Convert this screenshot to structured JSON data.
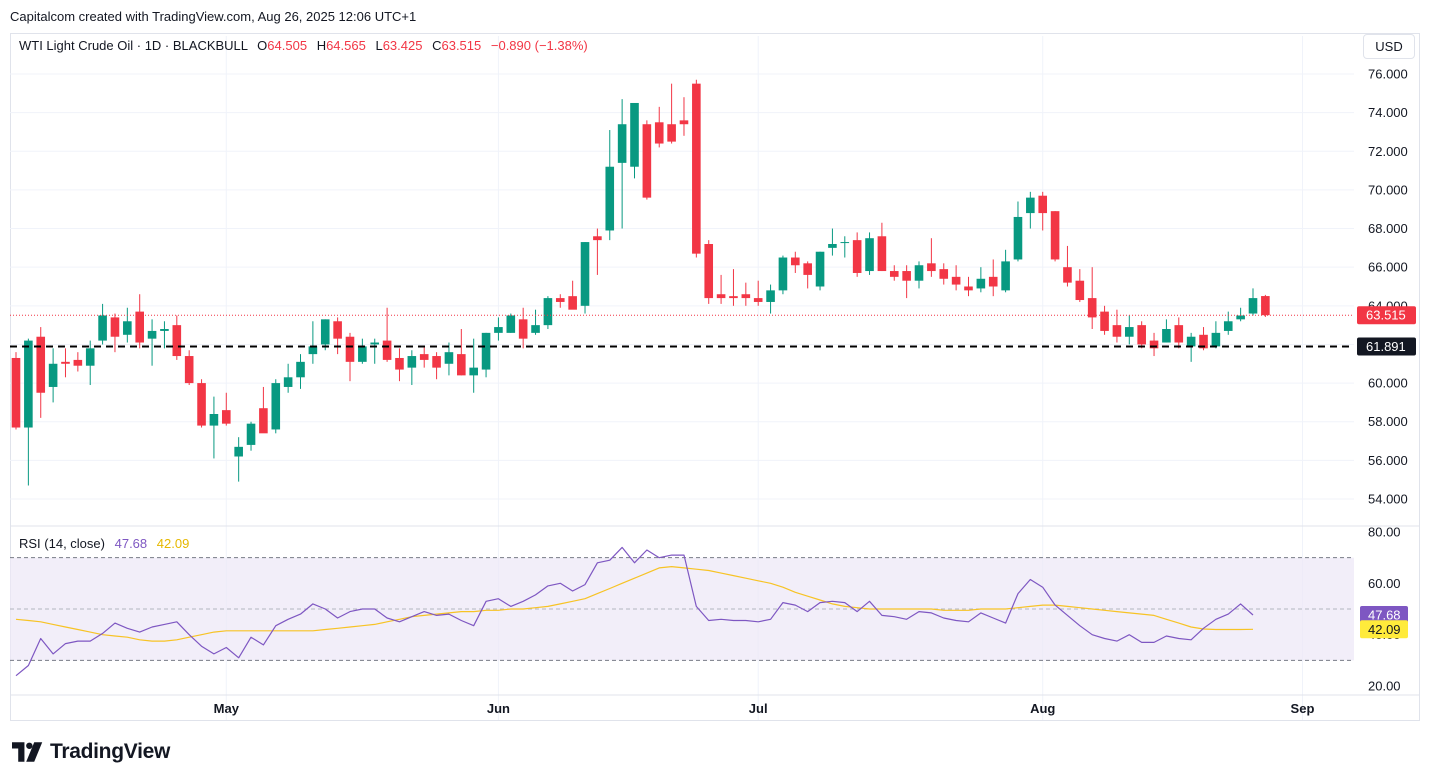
{
  "header": {
    "text": "Capitalcom created with TradingView.com, Aug 26, 2025 12:06 UTC+1"
  },
  "legend": {
    "symbol": "WTI Light Crude Oil · 1D · BLACKBULL",
    "o_label": "O",
    "o": "64.505",
    "h_label": "H",
    "h": "64.565",
    "l_label": "L",
    "l": "63.425",
    "c_label": "C",
    "c": "63.515",
    "change": "−0.890 (−1.38%)"
  },
  "currency": "USD",
  "rsi_legend": {
    "label": "RSI (14, close)",
    "rsi": "47.68",
    "ma": "42.09"
  },
  "brand": {
    "name": "TradingView",
    "icon": "tradingview-logo-icon"
  },
  "colors": {
    "up": "#089981",
    "down": "#f23645",
    "rsi": "#7e57c2",
    "rsi_ma": "#f7c325",
    "rsi_band": "#ede7f6"
  },
  "chart_data": [
    {
      "type": "candlestick",
      "price_ylim": [
        53,
        77
      ],
      "y_ticks": [
        "54.000",
        "56.000",
        "58.000",
        "60.000",
        "62.000",
        "64.000",
        "66.000",
        "68.000",
        "70.000",
        "72.000",
        "74.000",
        "76.000"
      ],
      "x_ticks": [
        {
          "label": "May",
          "date": "2025-05-01"
        },
        {
          "label": "Jun",
          "date": "2025-06-02"
        },
        {
          "label": "Jul",
          "date": "2025-07-01"
        },
        {
          "label": "Aug",
          "date": "2025-08-01"
        },
        {
          "label": "Sep",
          "date": "2025-09-01"
        }
      ],
      "candles": [
        {
          "date": "2025-04-07",
          "o": 61.3,
          "h": 61.6,
          "l": 57.6,
          "c": 57.7
        },
        {
          "date": "2025-04-08",
          "o": 57.7,
          "h": 62.3,
          "l": 54.7,
          "c": 62.2
        },
        {
          "date": "2025-04-09",
          "o": 62.4,
          "h": 62.9,
          "l": 58.2,
          "c": 59.5
        },
        {
          "date": "2025-04-10",
          "o": 59.8,
          "h": 61.8,
          "l": 59.0,
          "c": 61.0
        },
        {
          "date": "2025-04-11",
          "o": 61.1,
          "h": 61.8,
          "l": 60.3,
          "c": 61.0
        },
        {
          "date": "2025-04-14",
          "o": 61.2,
          "h": 61.6,
          "l": 60.6,
          "c": 60.9
        },
        {
          "date": "2025-04-15",
          "o": 60.9,
          "h": 62.2,
          "l": 59.9,
          "c": 61.8
        },
        {
          "date": "2025-04-16",
          "o": 62.2,
          "h": 64.1,
          "l": 62.0,
          "c": 63.5
        },
        {
          "date": "2025-04-17",
          "o": 63.4,
          "h": 63.6,
          "l": 61.6,
          "c": 62.4
        },
        {
          "date": "2025-04-21",
          "o": 62.5,
          "h": 63.9,
          "l": 62.1,
          "c": 63.2
        },
        {
          "date": "2025-04-22",
          "o": 63.7,
          "h": 64.6,
          "l": 61.8,
          "c": 62.1
        },
        {
          "date": "2025-04-23",
          "o": 62.3,
          "h": 63.3,
          "l": 60.9,
          "c": 62.7
        },
        {
          "date": "2025-04-24",
          "o": 62.7,
          "h": 63.2,
          "l": 61.8,
          "c": 62.8
        },
        {
          "date": "2025-04-25",
          "o": 63.0,
          "h": 63.5,
          "l": 61.2,
          "c": 61.4
        },
        {
          "date": "2025-04-28",
          "o": 61.4,
          "h": 61.7,
          "l": 59.9,
          "c": 60.0
        },
        {
          "date": "2025-04-29",
          "o": 60.0,
          "h": 60.2,
          "l": 57.7,
          "c": 57.8
        },
        {
          "date": "2025-04-30",
          "o": 57.8,
          "h": 59.3,
          "l": 56.1,
          "c": 58.4
        },
        {
          "date": "2025-05-01",
          "o": 58.6,
          "h": 59.5,
          "l": 57.8,
          "c": 57.9
        },
        {
          "date": "2025-05-02",
          "o": 56.2,
          "h": 57.2,
          "l": 54.9,
          "c": 56.7
        },
        {
          "date": "2025-05-05",
          "o": 56.8,
          "h": 58.0,
          "l": 56.5,
          "c": 57.9
        },
        {
          "date": "2025-05-06",
          "o": 58.7,
          "h": 59.8,
          "l": 57.6,
          "c": 57.4
        },
        {
          "date": "2025-05-07",
          "o": 57.6,
          "h": 60.2,
          "l": 57.4,
          "c": 60.0
        },
        {
          "date": "2025-05-08",
          "o": 59.8,
          "h": 61.0,
          "l": 59.5,
          "c": 60.3
        },
        {
          "date": "2025-05-09",
          "o": 60.3,
          "h": 61.5,
          "l": 59.7,
          "c": 61.1
        },
        {
          "date": "2025-05-12",
          "o": 61.5,
          "h": 63.2,
          "l": 61.0,
          "c": 61.9
        },
        {
          "date": "2025-05-13",
          "o": 62.0,
          "h": 63.3,
          "l": 61.7,
          "c": 63.3
        },
        {
          "date": "2025-05-14",
          "o": 63.2,
          "h": 63.4,
          "l": 61.5,
          "c": 62.3
        },
        {
          "date": "2025-05-15",
          "o": 62.4,
          "h": 62.6,
          "l": 60.1,
          "c": 61.1
        },
        {
          "date": "2025-05-16",
          "o": 61.1,
          "h": 62.3,
          "l": 61.0,
          "c": 61.9
        },
        {
          "date": "2025-05-19",
          "o": 62.0,
          "h": 62.3,
          "l": 61.0,
          "c": 62.1
        },
        {
          "date": "2025-05-20",
          "o": 62.2,
          "h": 63.9,
          "l": 61.1,
          "c": 61.2
        },
        {
          "date": "2025-05-21",
          "o": 61.3,
          "h": 61.8,
          "l": 60.1,
          "c": 60.7
        },
        {
          "date": "2025-05-22",
          "o": 60.8,
          "h": 61.7,
          "l": 59.9,
          "c": 61.4
        },
        {
          "date": "2025-05-23",
          "o": 61.5,
          "h": 61.9,
          "l": 60.8,
          "c": 61.2
        },
        {
          "date": "2025-05-26",
          "o": 61.4,
          "h": 61.6,
          "l": 60.2,
          "c": 60.8
        },
        {
          "date": "2025-05-27",
          "o": 61.0,
          "h": 62.1,
          "l": 60.4,
          "c": 61.6
        },
        {
          "date": "2025-05-28",
          "o": 61.5,
          "h": 62.8,
          "l": 60.4,
          "c": 60.4
        },
        {
          "date": "2025-05-29",
          "o": 60.4,
          "h": 62.3,
          "l": 59.5,
          "c": 60.8
        },
        {
          "date": "2025-05-30",
          "o": 60.7,
          "h": 62.6,
          "l": 60.3,
          "c": 62.6
        },
        {
          "date": "2025-06-02",
          "o": 62.6,
          "h": 63.4,
          "l": 62.2,
          "c": 62.9
        },
        {
          "date": "2025-06-03",
          "o": 62.6,
          "h": 63.6,
          "l": 62.6,
          "c": 63.5
        },
        {
          "date": "2025-06-04",
          "o": 63.3,
          "h": 63.9,
          "l": 61.8,
          "c": 62.3
        },
        {
          "date": "2025-06-05",
          "o": 62.6,
          "h": 63.8,
          "l": 62.5,
          "c": 63.0
        },
        {
          "date": "2025-06-06",
          "o": 63.0,
          "h": 64.5,
          "l": 62.8,
          "c": 64.4
        },
        {
          "date": "2025-06-09",
          "o": 64.4,
          "h": 64.6,
          "l": 63.9,
          "c": 64.2
        },
        {
          "date": "2025-06-10",
          "o": 64.5,
          "h": 65.3,
          "l": 63.9,
          "c": 63.8
        },
        {
          "date": "2025-06-11",
          "o": 64.0,
          "h": 67.3,
          "l": 63.6,
          "c": 67.3
        },
        {
          "date": "2025-06-12",
          "o": 67.6,
          "h": 68.0,
          "l": 65.6,
          "c": 67.4
        },
        {
          "date": "2025-06-13",
          "o": 67.9,
          "h": 73.1,
          "l": 67.4,
          "c": 71.2
        },
        {
          "date": "2025-06-16",
          "o": 71.4,
          "h": 74.7,
          "l": 68.0,
          "c": 73.4
        },
        {
          "date": "2025-06-17",
          "o": 71.2,
          "h": 74.5,
          "l": 70.6,
          "c": 74.5
        },
        {
          "date": "2025-06-18",
          "o": 73.4,
          "h": 73.6,
          "l": 69.5,
          "c": 69.6
        },
        {
          "date": "2025-06-19",
          "o": 73.5,
          "h": 74.3,
          "l": 72.2,
          "c": 72.4
        },
        {
          "date": "2025-06-20",
          "o": 73.4,
          "h": 75.5,
          "l": 72.4,
          "c": 72.5
        },
        {
          "date": "2025-06-23",
          "o": 73.6,
          "h": 74.8,
          "l": 72.8,
          "c": 73.4
        },
        {
          "date": "2025-06-24",
          "o": 75.5,
          "h": 75.7,
          "l": 66.5,
          "c": 66.7
        },
        {
          "date": "2025-06-25",
          "o": 67.2,
          "h": 67.4,
          "l": 64.1,
          "c": 64.4
        },
        {
          "date": "2025-06-26",
          "o": 64.6,
          "h": 65.6,
          "l": 64.1,
          "c": 64.4
        },
        {
          "date": "2025-06-27",
          "o": 64.5,
          "h": 65.9,
          "l": 64.0,
          "c": 64.4
        },
        {
          "date": "2025-06-30",
          "o": 64.6,
          "h": 65.2,
          "l": 64.0,
          "c": 64.4
        },
        {
          "date": "2025-07-01",
          "o": 64.4,
          "h": 65.3,
          "l": 64.0,
          "c": 64.2
        },
        {
          "date": "2025-07-02",
          "o": 64.2,
          "h": 65.1,
          "l": 63.6,
          "c": 64.8
        },
        {
          "date": "2025-07-03",
          "o": 64.8,
          "h": 66.6,
          "l": 64.6,
          "c": 66.5
        },
        {
          "date": "2025-07-04",
          "o": 66.5,
          "h": 66.8,
          "l": 65.7,
          "c": 66.1
        },
        {
          "date": "2025-07-07",
          "o": 66.2,
          "h": 66.3,
          "l": 64.9,
          "c": 65.6
        },
        {
          "date": "2025-07-08",
          "o": 65.0,
          "h": 66.8,
          "l": 64.8,
          "c": 66.8
        },
        {
          "date": "2025-07-09",
          "o": 67.0,
          "h": 68.0,
          "l": 66.6,
          "c": 67.2
        },
        {
          "date": "2025-07-10",
          "o": 67.3,
          "h": 67.6,
          "l": 66.5,
          "c": 67.3
        },
        {
          "date": "2025-07-11",
          "o": 67.4,
          "h": 67.8,
          "l": 65.5,
          "c": 65.7
        },
        {
          "date": "2025-07-14",
          "o": 65.8,
          "h": 67.8,
          "l": 65.6,
          "c": 67.5
        },
        {
          "date": "2025-07-15",
          "o": 67.6,
          "h": 68.3,
          "l": 65.8,
          "c": 65.8
        },
        {
          "date": "2025-07-16",
          "o": 65.8,
          "h": 66.1,
          "l": 65.3,
          "c": 65.5
        },
        {
          "date": "2025-07-17",
          "o": 65.8,
          "h": 66.1,
          "l": 64.4,
          "c": 65.3
        },
        {
          "date": "2025-07-18",
          "o": 65.3,
          "h": 66.3,
          "l": 64.9,
          "c": 66.1
        },
        {
          "date": "2025-07-21",
          "o": 66.2,
          "h": 67.5,
          "l": 65.5,
          "c": 65.8
        },
        {
          "date": "2025-07-22",
          "o": 65.9,
          "h": 66.2,
          "l": 65.1,
          "c": 65.4
        },
        {
          "date": "2025-07-23",
          "o": 65.5,
          "h": 66.1,
          "l": 64.8,
          "c": 65.1
        },
        {
          "date": "2025-07-24",
          "o": 65.0,
          "h": 65.5,
          "l": 64.5,
          "c": 64.8
        },
        {
          "date": "2025-07-25",
          "o": 64.9,
          "h": 66.0,
          "l": 64.7,
          "c": 65.4
        },
        {
          "date": "2025-07-28",
          "o": 65.5,
          "h": 66.4,
          "l": 64.5,
          "c": 65.0
        },
        {
          "date": "2025-07-29",
          "o": 64.8,
          "h": 66.9,
          "l": 64.7,
          "c": 66.3
        },
        {
          "date": "2025-07-30",
          "o": 66.4,
          "h": 69.4,
          "l": 66.3,
          "c": 68.6
        },
        {
          "date": "2025-07-31",
          "o": 68.8,
          "h": 69.9,
          "l": 68.0,
          "c": 69.6
        },
        {
          "date": "2025-08-01",
          "o": 69.7,
          "h": 69.9,
          "l": 67.9,
          "c": 68.8
        },
        {
          "date": "2025-08-04",
          "o": 68.9,
          "h": 68.9,
          "l": 66.3,
          "c": 66.4
        },
        {
          "date": "2025-08-05",
          "o": 66.0,
          "h": 67.1,
          "l": 65.0,
          "c": 65.2
        },
        {
          "date": "2025-08-06",
          "o": 65.3,
          "h": 65.9,
          "l": 64.2,
          "c": 64.3
        },
        {
          "date": "2025-08-07",
          "o": 64.4,
          "h": 66.0,
          "l": 62.8,
          "c": 63.4
        },
        {
          "date": "2025-08-08",
          "o": 63.7,
          "h": 64.0,
          "l": 62.5,
          "c": 62.7
        },
        {
          "date": "2025-08-11",
          "o": 63.0,
          "h": 63.8,
          "l": 62.1,
          "c": 62.4
        },
        {
          "date": "2025-08-12",
          "o": 62.4,
          "h": 63.5,
          "l": 62.0,
          "c": 62.9
        },
        {
          "date": "2025-08-13",
          "o": 63.0,
          "h": 63.2,
          "l": 61.8,
          "c": 62.0
        },
        {
          "date": "2025-08-14",
          "o": 62.2,
          "h": 62.6,
          "l": 61.4,
          "c": 61.8
        },
        {
          "date": "2025-08-15",
          "o": 62.1,
          "h": 63.3,
          "l": 62.1,
          "c": 62.8
        },
        {
          "date": "2025-08-18",
          "o": 63.0,
          "h": 63.4,
          "l": 61.8,
          "c": 62.1
        },
        {
          "date": "2025-08-19",
          "o": 61.9,
          "h": 62.6,
          "l": 61.1,
          "c": 62.4
        },
        {
          "date": "2025-08-20",
          "o": 62.5,
          "h": 62.9,
          "l": 61.7,
          "c": 61.8
        },
        {
          "date": "2025-08-21",
          "o": 61.9,
          "h": 63.2,
          "l": 61.8,
          "c": 62.6
        },
        {
          "date": "2025-08-22",
          "o": 62.7,
          "h": 63.7,
          "l": 62.5,
          "c": 63.2
        },
        {
          "date": "2025-08-25",
          "o": 63.3,
          "h": 63.9,
          "l": 63.2,
          "c": 63.5
        },
        {
          "date": "2025-08-26",
          "o": 63.6,
          "h": 64.9,
          "l": 63.5,
          "c": 64.4
        },
        {
          "date": "2025-08-27",
          "o": 64.505,
          "h": 64.565,
          "l": 63.425,
          "c": 63.515
        }
      ],
      "last_price": {
        "value": 63.515,
        "label": "63.515"
      },
      "support_line": {
        "value": 61.891,
        "label": "61.891",
        "style": "dashed"
      }
    },
    {
      "type": "line",
      "title": "RSI (14, close)",
      "ylim": [
        15,
        84
      ],
      "y_ticks": [
        "20.00",
        "40.00",
        "60.00",
        "80.00"
      ],
      "overbought": 70,
      "middle": 50,
      "oversold": 30,
      "series": [
        {
          "name": "RSI",
          "last_label": "47.68",
          "values": [
            24,
            28,
            38.5,
            32.5,
            36.5,
            37.5,
            37.5,
            40.5,
            44.5,
            42.5,
            41,
            43,
            44,
            45,
            40,
            35.5,
            32.5,
            35,
            31,
            39,
            36,
            43.5,
            46,
            48,
            52,
            50,
            46.5,
            49,
            50,
            50,
            46.5,
            45,
            47,
            49,
            47.5,
            48,
            45.5,
            43.5,
            53,
            54,
            51,
            53,
            55.5,
            59,
            60,
            57,
            59.5,
            68,
            69,
            74,
            68,
            73,
            70,
            71,
            71,
            51,
            45.5,
            46,
            45.5,
            45.5,
            45,
            46,
            52.5,
            51.5,
            49,
            52.5,
            53,
            52.5,
            49,
            53,
            47.5,
            47,
            46,
            49,
            48.5,
            46.5,
            45.5,
            45,
            48.5,
            46.5,
            44.5,
            56,
            61.5,
            58.5,
            51.5,
            47.5,
            43.5,
            40,
            38.5,
            37.5,
            40,
            37,
            37,
            39.5,
            38.5,
            38,
            42.5,
            46,
            48,
            52,
            47.68
          ]
        },
        {
          "name": "RSI-based MA",
          "last_label": "42.09",
          "values": [
            46,
            45.5,
            45,
            44,
            43,
            42,
            41,
            40,
            39.5,
            39,
            38,
            37.5,
            37.5,
            38,
            39,
            40,
            41,
            41.5,
            41.5,
            41.5,
            41.5,
            41.5,
            41.5,
            41.5,
            41.5,
            42,
            42.5,
            43,
            43.5,
            44,
            45,
            46,
            47,
            47.5,
            48,
            48.5,
            49,
            49,
            49.5,
            49.5,
            50,
            50,
            50.5,
            51,
            52,
            53,
            54,
            56,
            58,
            60,
            62,
            64,
            66,
            66.5,
            66,
            65.5,
            65,
            64,
            63,
            62,
            61,
            60,
            58.5,
            56.5,
            55,
            53.5,
            52,
            51,
            50.5,
            50,
            50,
            50,
            50,
            50,
            50,
            49.5,
            49.5,
            49.5,
            50,
            50,
            50,
            50.5,
            51,
            51.5,
            51.5,
            51,
            50.5,
            50,
            49.5,
            49,
            48.5,
            48,
            47.5,
            46,
            44.5,
            43,
            42.2,
            42,
            42,
            42,
            42.09
          ]
        }
      ]
    }
  ]
}
